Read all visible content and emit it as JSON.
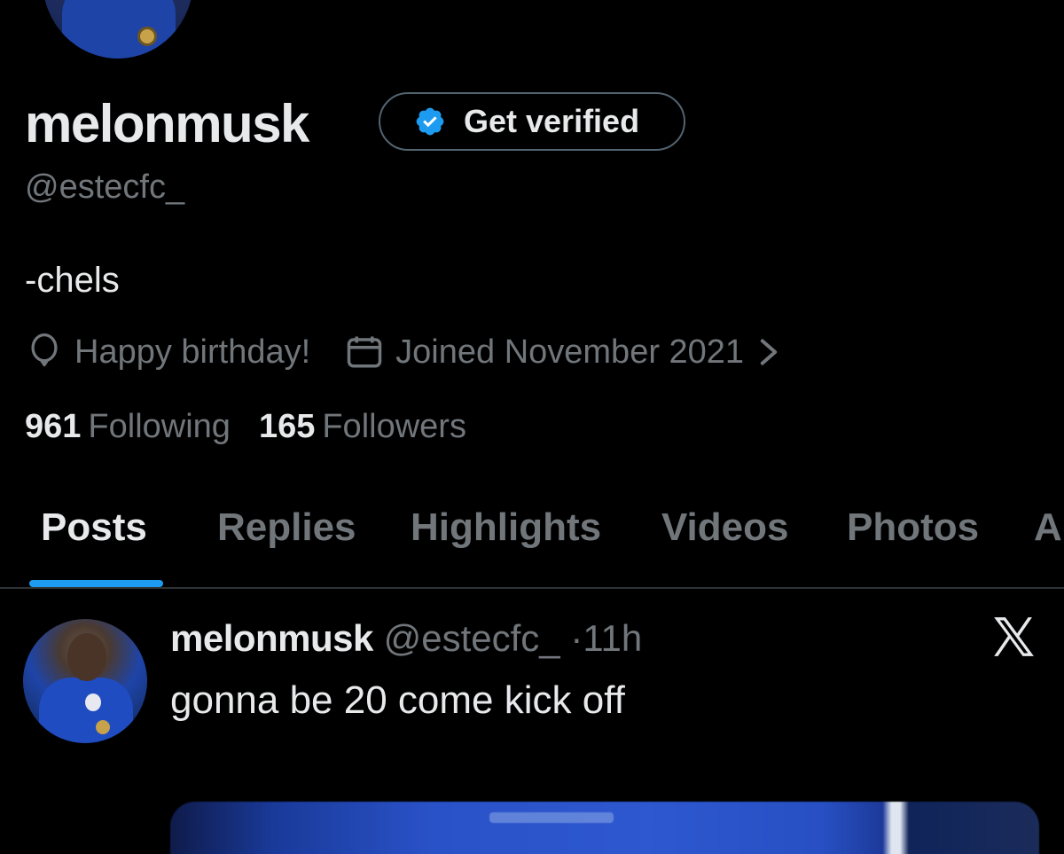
{
  "profile": {
    "display_name": "melonmusk",
    "get_verified_label": "Get verified",
    "handle": "@estecfc_",
    "bio": "-chels",
    "birthday_text": "Happy birthday!",
    "joined_text": "Joined November 2021",
    "following_count": "961",
    "following_label": "Following",
    "followers_count": "165",
    "followers_label": "Followers"
  },
  "tabs": [
    {
      "label": "Posts",
      "active": true
    },
    {
      "label": "Replies",
      "active": false
    },
    {
      "label": "Highlights",
      "active": false
    },
    {
      "label": "Videos",
      "active": false
    },
    {
      "label": "Photos",
      "active": false
    },
    {
      "label": "A",
      "active": false
    }
  ],
  "post": {
    "name": "melonmusk",
    "handle": "@estecfc_",
    "separator": "·",
    "time": "11h",
    "text": "gonna be 20 come kick off"
  },
  "colors": {
    "background": "#000000",
    "primary_text": "#e7e9ea",
    "secondary_text": "#71767b",
    "accent": "#1d9bf0",
    "divider": "#2f3336"
  },
  "icons": {
    "verified": "verified-badge-icon",
    "birthday": "balloon-icon",
    "joined": "calendar-icon",
    "chevron": "chevron-right-icon",
    "grok": "x-logo-icon"
  }
}
